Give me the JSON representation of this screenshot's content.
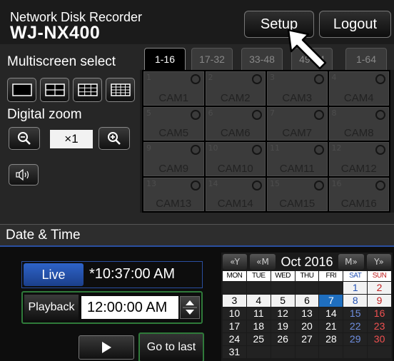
{
  "header": {
    "brand_sub": "Network Disk Recorder",
    "brand_main": "WJ-NX400",
    "setup_label": "Setup",
    "logout_label": "Logout"
  },
  "left_panel": {
    "multiscreen_label": "Multiscreen select",
    "digital_zoom_label": "Digital zoom",
    "zoom_value": "×1",
    "layout_icons": [
      "1-screen-icon",
      "4-screen-icon",
      "9-screen-icon",
      "16-screen-icon"
    ]
  },
  "tabs": [
    {
      "label": "1-16",
      "active": true
    },
    {
      "label": "17-32",
      "active": false
    },
    {
      "label": "33-48",
      "active": false
    },
    {
      "label": "49-64",
      "active": false
    },
    {
      "label": "1-64",
      "active": false
    }
  ],
  "cameras": [
    {
      "num": "1",
      "name": "CAM1"
    },
    {
      "num": "2",
      "name": "CAM2"
    },
    {
      "num": "3",
      "name": "CAM3"
    },
    {
      "num": "4",
      "name": "CAM4"
    },
    {
      "num": "5",
      "name": "CAM5"
    },
    {
      "num": "6",
      "name": "CAM6"
    },
    {
      "num": "7",
      "name": "CAM7"
    },
    {
      "num": "8",
      "name": "CAM8"
    },
    {
      "num": "9",
      "name": "CAM9"
    },
    {
      "num": "10",
      "name": "CAM10"
    },
    {
      "num": "11",
      "name": "CAM11"
    },
    {
      "num": "12",
      "name": "CAM12"
    },
    {
      "num": "13",
      "name": "CAM13"
    },
    {
      "num": "14",
      "name": "CAM14"
    },
    {
      "num": "15",
      "name": "CAM15"
    },
    {
      "num": "16",
      "name": "CAM16"
    }
  ],
  "datetime": {
    "title": "Date & Time",
    "live_label": "Live",
    "live_time": "*10:37:00 AM",
    "playback_label": "Playback",
    "playback_time": "12:00:00 AM",
    "goto_last_label": "Go to last"
  },
  "calendar": {
    "month": "Oct 2016",
    "nav_prev_year": "«Y",
    "nav_prev_month": "«M",
    "nav_next_month": "M»",
    "nav_next_year": "Y»",
    "weekdays": [
      "MON",
      "TUE",
      "WED",
      "THU",
      "FRI",
      "SAT",
      "SUN"
    ],
    "weeks": [
      [
        "",
        "",
        "",
        "",
        "",
        "1",
        "2"
      ],
      [
        "3",
        "4",
        "5",
        "6",
        "7",
        "8",
        "9"
      ],
      [
        "10",
        "11",
        "12",
        "13",
        "14",
        "15",
        "16"
      ],
      [
        "17",
        "18",
        "19",
        "20",
        "21",
        "22",
        "23"
      ],
      [
        "24",
        "25",
        "26",
        "27",
        "28",
        "29",
        "30"
      ],
      [
        "31",
        "",
        "",
        "",
        "",
        "",
        ""
      ]
    ],
    "selected_day": "7",
    "last_recorded_day": "9",
    "colors": {
      "selected": "#1f6fc0",
      "saturday": "#2452b4",
      "sunday": "#c02020"
    }
  }
}
